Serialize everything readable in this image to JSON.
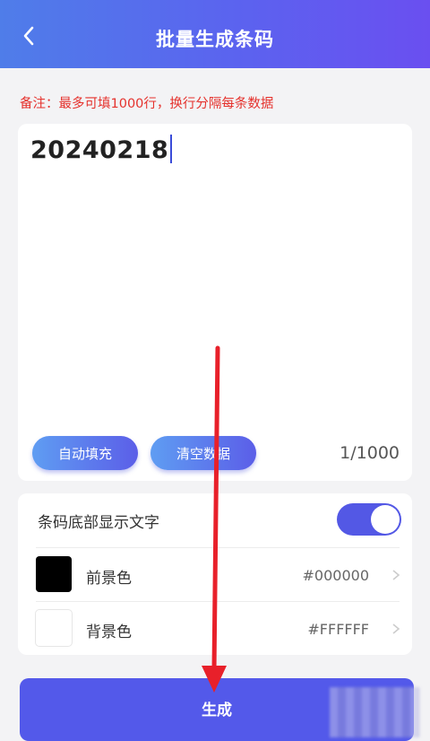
{
  "header": {
    "title": "批量生成条码",
    "back_icon": "chevron-left-icon"
  },
  "note": "备注：最多可填1000行，换行分隔每条数据",
  "input": {
    "value": "20240218"
  },
  "buttons": {
    "auto_fill": "自动填充",
    "clear_data": "清空数据"
  },
  "counter": "1/1000",
  "settings": {
    "show_text_label": "条码底部显示文字",
    "show_text_enabled": true,
    "foreground": {
      "label": "前景色",
      "hex": "#000000"
    },
    "background": {
      "label": "背景色",
      "hex": "#FFFFFF"
    }
  },
  "generate_label": "生成",
  "colors": {
    "accent": "#5359EA",
    "note": "#E5322D",
    "annotation_arrow": "#E8202A"
  }
}
